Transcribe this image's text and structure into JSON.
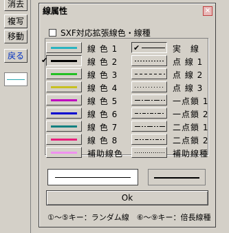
{
  "toolbar": {
    "buttons": [
      {
        "label": "消去"
      },
      {
        "label": "複写"
      },
      {
        "label": "移動"
      },
      {
        "label": "戻る"
      }
    ]
  },
  "dialog": {
    "title": "線属性",
    "close_glyph": "×",
    "sxf_label": "SXF対応拡張線色・線種",
    "colors": [
      {
        "label": "線 色 1",
        "color": "#2ab4c0",
        "selected": false
      },
      {
        "label": "線 色 2",
        "color": "#000000",
        "selected": true
      },
      {
        "label": "線 色 3",
        "color": "#22c022",
        "selected": false
      },
      {
        "label": "線 色 4",
        "color": "#c8c020",
        "selected": false
      },
      {
        "label": "線 色 5",
        "color": "#c000c0",
        "selected": false
      },
      {
        "label": "線 色 6",
        "color": "#0000d0",
        "selected": false
      },
      {
        "label": "線 色 7",
        "color": "#108080",
        "selected": false
      },
      {
        "label": "線 色 8",
        "color": "#e8207c",
        "selected": false
      },
      {
        "label": "補助線色",
        "color": "#f090f0",
        "selected": false
      }
    ],
    "linetypes": [
      {
        "label": "実　線",
        "pattern": "solid",
        "selected": true
      },
      {
        "label": "点 線 1",
        "pattern": "dot1",
        "selected": false
      },
      {
        "label": "点 線 2",
        "pattern": "dot2",
        "selected": false
      },
      {
        "label": "点 線 3",
        "pattern": "dot3",
        "selected": false
      },
      {
        "label": "一点鎖 1",
        "pattern": "dashdot1",
        "selected": false
      },
      {
        "label": "一点鎖 2",
        "pattern": "dashdot2",
        "selected": false
      },
      {
        "label": "二点鎖 1",
        "pattern": "dashdotdot1",
        "selected": false
      },
      {
        "label": "二点鎖 2",
        "pattern": "dashdotdot2",
        "selected": false
      },
      {
        "label": "補助線種",
        "pattern": "aux",
        "selected": false
      }
    ],
    "selected_check": "✔",
    "ok_label": "Ok",
    "help_text": "①～⑤キー：ランダム線　⑥～⑨キー：倍長線種"
  }
}
